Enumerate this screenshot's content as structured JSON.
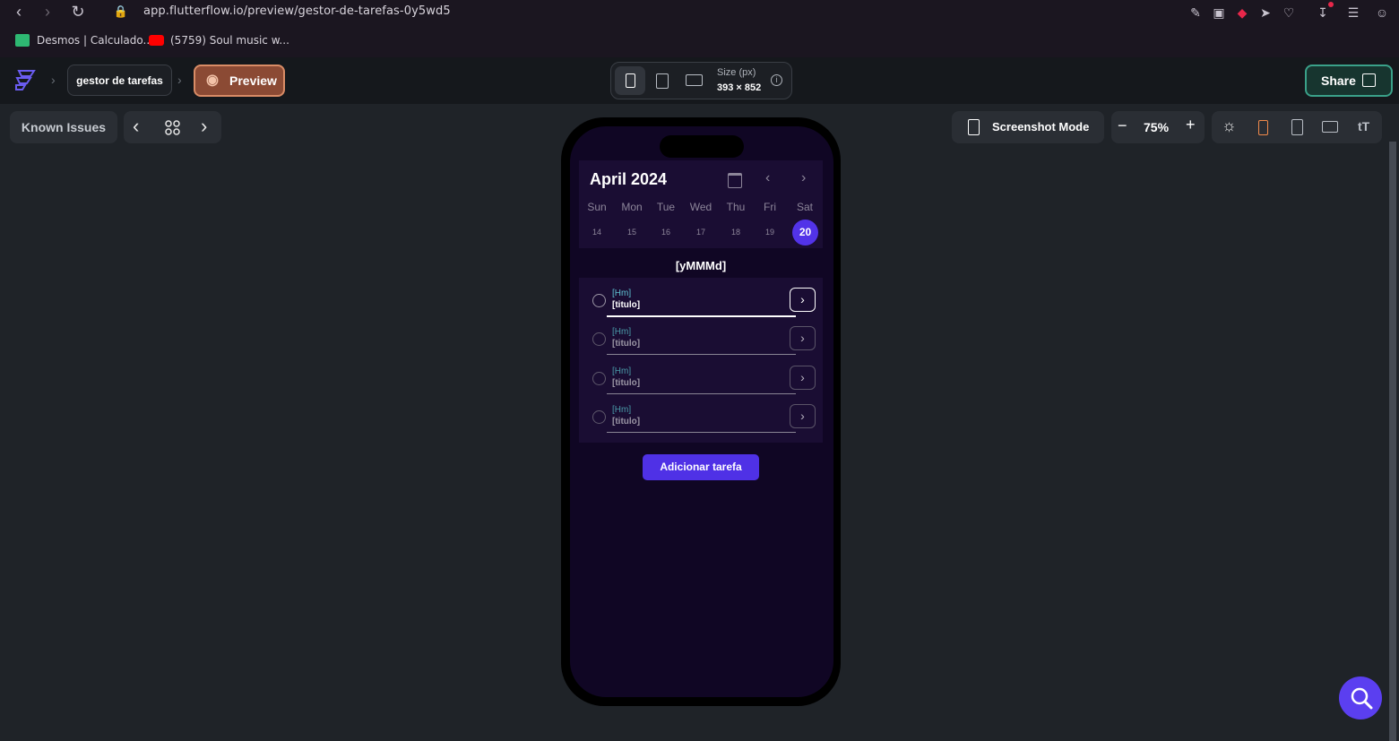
{
  "browser": {
    "url": "app.flutterflow.io/preview/gestor-de-tarefas-0y5wd5",
    "bookmarks": [
      {
        "label": "Desmos | Calculado...",
        "icon": "desmos-icon",
        "color": "#2eb872"
      },
      {
        "label": "(5759) Soul music w...",
        "icon": "youtube-icon",
        "color": "#ff0000"
      }
    ]
  },
  "header": {
    "project_name": "gestor de tarefas",
    "preview_label": "Preview",
    "size_label": "Size (px)",
    "size_value": "393 × 852",
    "share_label": "Share"
  },
  "toolbar": {
    "known_issues_label": "Known Issues",
    "screenshot_mode_label": "Screenshot Mode",
    "zoom_value": "75%"
  },
  "app": {
    "month_label": "April 2024",
    "weekdays": [
      "Sun",
      "Mon",
      "Tue",
      "Wed",
      "Thu",
      "Fri",
      "Sat"
    ],
    "days": [
      "14",
      "15",
      "16",
      "17",
      "18",
      "19",
      "20"
    ],
    "selected_day": "20",
    "date_label": "[yMMMd]",
    "tasks": [
      {
        "time": "[Hm]",
        "title": "[titulo]"
      },
      {
        "time": "[Hm]",
        "title": "[titulo]"
      },
      {
        "time": "[Hm]",
        "title": "[titulo]"
      },
      {
        "time": "[Hm]",
        "title": "[titulo]"
      }
    ],
    "add_task_label": "Adicionar tarefa"
  },
  "colors": {
    "accent": "#5233e8",
    "preview_orange": "#d98c66",
    "share_green": "#3aa189"
  }
}
